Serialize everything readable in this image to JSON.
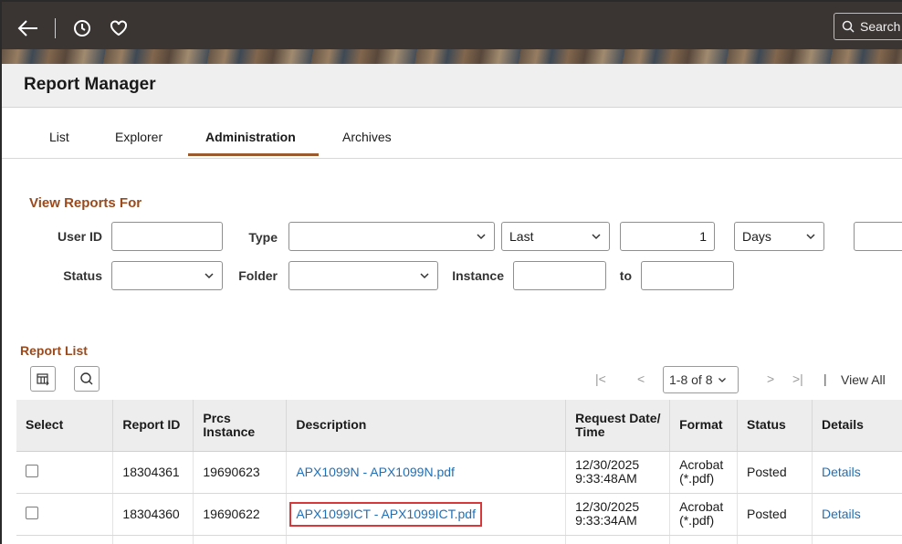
{
  "nav": {
    "back_icon": "back-arrow-icon",
    "recent_icon": "clock-icon",
    "favorites_icon": "heart-icon",
    "search_placeholder": "Search"
  },
  "page": {
    "title": "Report Manager"
  },
  "tabs": [
    {
      "label": "List",
      "active": false
    },
    {
      "label": "Explorer",
      "active": false
    },
    {
      "label": "Administration",
      "active": true
    },
    {
      "label": "Archives",
      "active": false
    }
  ],
  "criteria": {
    "title": "View Reports For",
    "user_id_label": "User ID",
    "user_id_value": "",
    "type_label": "Type",
    "type_value": "",
    "period_value": "Last",
    "count_value": "1",
    "unit_value": "Days",
    "status_label": "Status",
    "status_value": "",
    "folder_label": "Folder",
    "folder_value": "",
    "instance_label": "Instance",
    "instance_from": "",
    "to_label": "to",
    "instance_to": ""
  },
  "report_list": {
    "title": "Report List",
    "pager": {
      "range": "1-8 of 8",
      "view_all": "View All"
    },
    "columns": {
      "select": "Select",
      "report_id": "Report ID",
      "prcs_instance": "Prcs Instance",
      "description": "Description",
      "request_time": "Request Date/ Time",
      "format": "Format",
      "status": "Status",
      "details": "Details"
    },
    "rows": [
      {
        "report_id": "18304361",
        "prcs_instance": "19690623",
        "description": "APX1099N - APX1099N.pdf",
        "request_date": "12/30/2025",
        "request_time": "9:33:48AM",
        "format_line1": "Acrobat",
        "format_line2": "(*.pdf)",
        "status": "Posted",
        "details": "Details"
      },
      {
        "report_id": "18304360",
        "prcs_instance": "19690622",
        "description": "APX1099ICT - APX1099ICT.pdf",
        "request_date": "12/30/2025",
        "request_time": "9:33:34AM",
        "format_line1": "Acrobat",
        "format_line2": "(*.pdf)",
        "status": "Posted",
        "details": "Details"
      }
    ]
  },
  "colors": {
    "accent": "#9a4a1c",
    "tab_underline": "#9a5a2e",
    "link": "#1f6fb8",
    "highlight": "#d6393a"
  }
}
